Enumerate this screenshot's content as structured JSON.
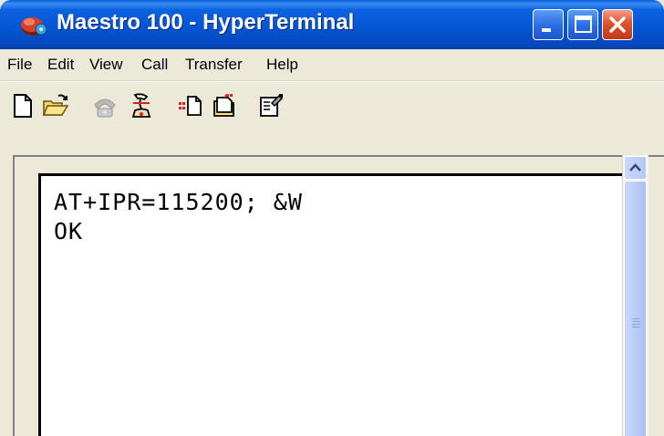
{
  "window": {
    "title": "Maestro 100 - HyperTerminal",
    "controls": [
      "minimize-icon",
      "maximize-icon",
      "close-icon"
    ]
  },
  "menu": {
    "items": [
      {
        "label": "File"
      },
      {
        "label": "Edit"
      },
      {
        "label": "View"
      },
      {
        "label": "Call"
      },
      {
        "label": "Transfer"
      },
      {
        "label": "Help"
      }
    ]
  },
  "toolbar": {
    "icons": [
      "new-connection-icon",
      "open-icon",
      "connect-icon",
      "disconnect-icon",
      "send-icon",
      "receive-icon",
      "properties-icon"
    ]
  },
  "terminal": {
    "lines": [
      "AT+IPR=115200; &W",
      "OK"
    ]
  },
  "colors": {
    "titlebar": "#0553d0",
    "close_button": "#e0522a",
    "window_bg": "#ece9d8",
    "terminal_bg": "#ffffff"
  }
}
